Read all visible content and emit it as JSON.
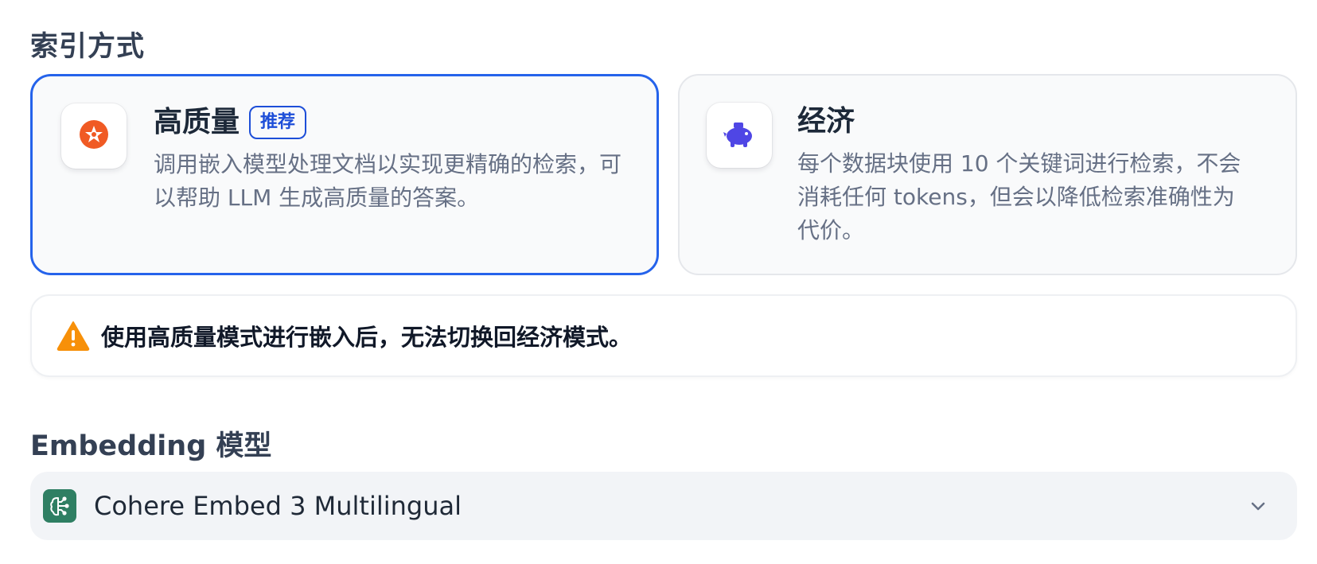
{
  "index_section": {
    "title": "索引方式"
  },
  "options": {
    "high_quality": {
      "title": "高质量",
      "badge": "推荐",
      "description": "调用嵌入模型处理文档以实现更精确的检索，可以帮助 LLM 生成高质量的答案。",
      "selected": true,
      "icon": "sparkle-icon",
      "accent": "#f05a24"
    },
    "economy": {
      "title": "经济",
      "description": "每个数据块使用 10 个关键词进行检索，不会消耗任何 tokens，但会以降低检索准确性为代价。",
      "selected": false,
      "icon": "piggy-bank-icon",
      "accent": "#4f46e5"
    }
  },
  "warning": {
    "icon": "warning-icon",
    "text": "使用高质量模式进行嵌入后，无法切换回经济模式。",
    "icon_color": "#f79009"
  },
  "embedding": {
    "title": "Embedding 模型",
    "selected_model": "Cohere Embed 3 Multilingual",
    "model_icon": "brain-icon",
    "icon_color": "#2f7f63"
  },
  "colors": {
    "selected_border": "#2563eb",
    "badge": "#1d4ed8"
  }
}
